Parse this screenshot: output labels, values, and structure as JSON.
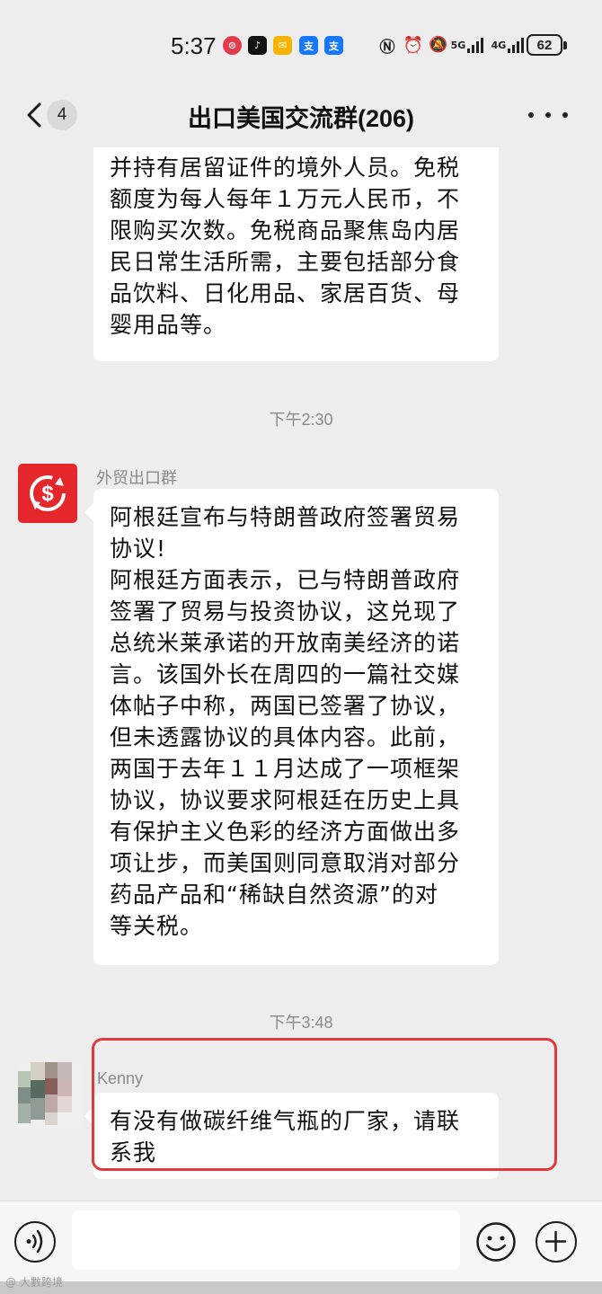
{
  "status_bar": {
    "time": "5:37",
    "signal_5g": "5G",
    "signal_4g": "4G",
    "battery": "62"
  },
  "nav": {
    "unread_count": "4",
    "title": "出口美国交流群(206)"
  },
  "messages": [
    {
      "type": "text",
      "lines": [
        "并持有居留证件的境外人员。免税",
        "额度为每人每年１万元人民币，不",
        "限购买次数。免税商品聚焦岛内居",
        "民日常生活所需，主要包括部分食",
        "品饮料、日化用品、家居百货、母",
        "婴用品等。"
      ]
    },
    {
      "type": "timestamp",
      "text": "下午2:30"
    },
    {
      "type": "text",
      "sender": "外贸出口群",
      "lines": [
        "阿根廷宣布与特朗普政府签署贸易",
        "协议!",
        "阿根廷方面表示，已与特朗普政府",
        "签署了贸易与投资协议，这兑现了",
        "总统米莱承诺的开放南美经济的诺",
        "言。该国外长在周四的一篇社交媒",
        "体帖子中称，两国已签署了协议，",
        "但未透露协议的具体内容。此前，",
        "两国于去年１１月达成了一项框架",
        "协议，协议要求阿根廷在历史上具",
        "有保护主义色彩的经济方面做出多",
        "项让步，而美国则同意取消对部分",
        "药品产品和“稀缺自然资源”的对",
        "等关税。"
      ]
    },
    {
      "type": "timestamp",
      "text": "下午3:48"
    },
    {
      "type": "text",
      "sender": "Kenny",
      "lines": [
        "有没有做碳纤维气瓶的厂家，请联",
        "系我"
      ]
    }
  ],
  "watermark": "@ 大數跨境",
  "colors": {
    "background": "#ededed",
    "bubble": "#ffffff",
    "avatar_red": "#e5262b",
    "highlight": "#e0393e"
  }
}
